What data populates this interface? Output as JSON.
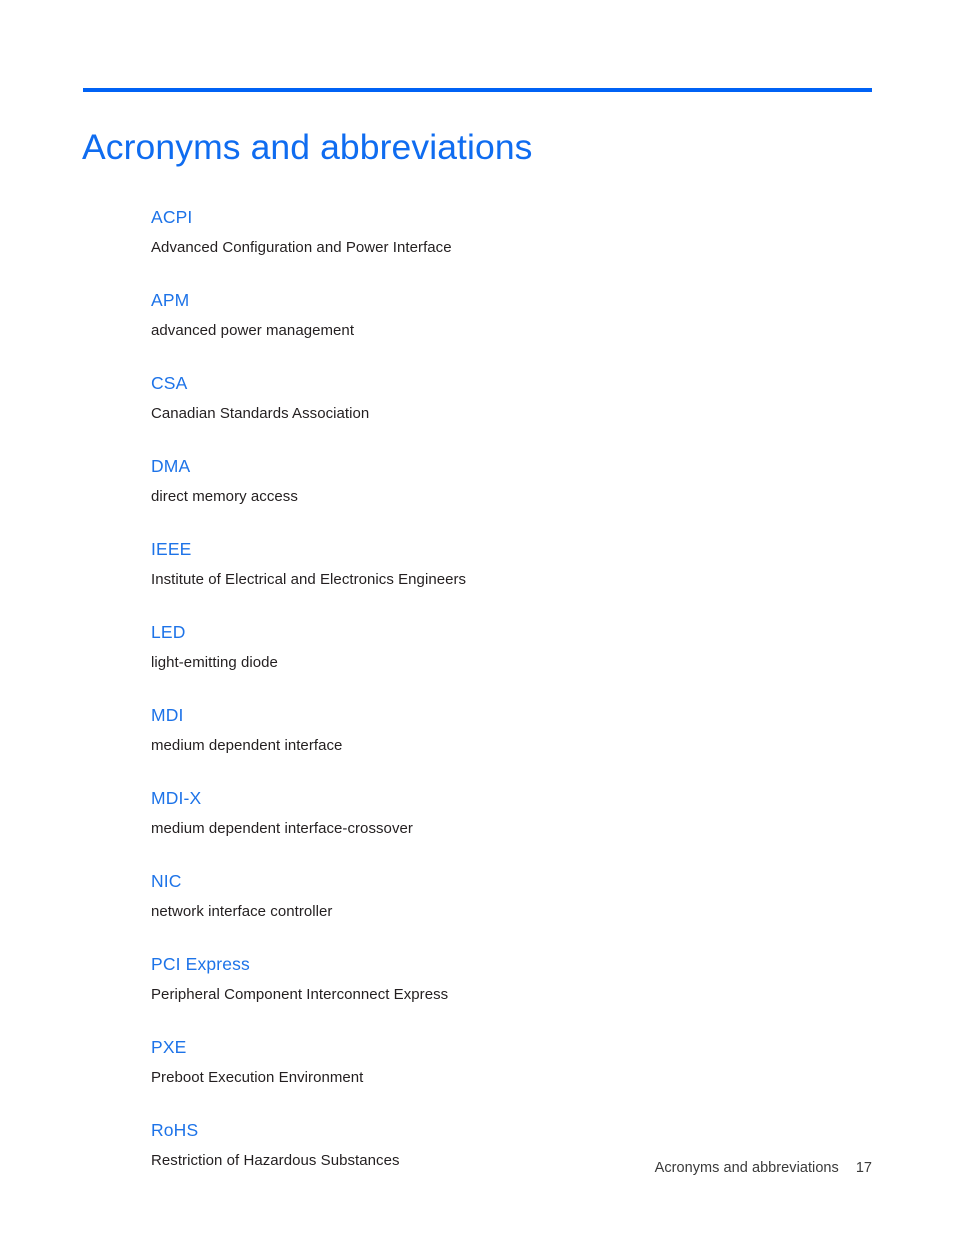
{
  "document": {
    "title": "Acronyms and abbreviations",
    "accent_color": "#0062f5",
    "title_color": "#0f6cf0",
    "term_color": "#1d73e8",
    "definition_color": "#231f20",
    "background_color": "#ffffff"
  },
  "glossary": [
    {
      "term": "ACPI",
      "definition": "Advanced Configuration and Power Interface"
    },
    {
      "term": "APM",
      "definition": "advanced power management"
    },
    {
      "term": "CSA",
      "definition": "Canadian Standards Association"
    },
    {
      "term": "DMA",
      "definition": "direct memory access"
    },
    {
      "term": "IEEE",
      "definition": "Institute of Electrical and Electronics Engineers"
    },
    {
      "term": "LED",
      "definition": "light-emitting diode"
    },
    {
      "term": "MDI",
      "definition": "medium dependent interface"
    },
    {
      "term": "MDI-X",
      "definition": "medium dependent interface-crossover"
    },
    {
      "term": "NIC",
      "definition": "network interface controller"
    },
    {
      "term": "PCI Express",
      "definition": "Peripheral Component Interconnect Express"
    },
    {
      "term": "PXE",
      "definition": "Preboot Execution Environment"
    },
    {
      "term": "RoHS",
      "definition": "Restriction of Hazardous Substances"
    }
  ],
  "footer": {
    "label": "Acronyms and abbreviations",
    "page_number": "17"
  }
}
